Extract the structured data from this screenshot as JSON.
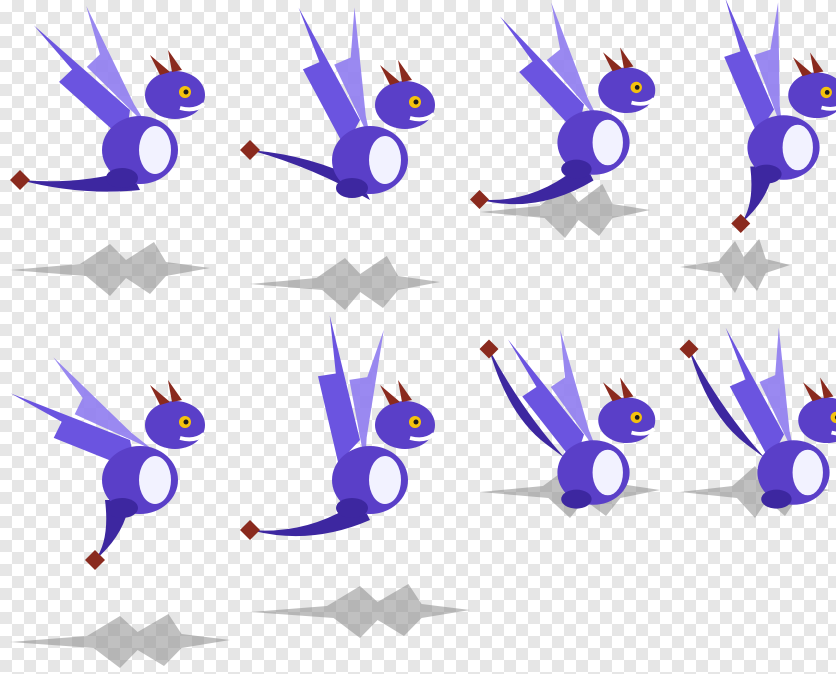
{
  "sprite_sheet": {
    "rows": 2,
    "columns": 4,
    "frame_count": 8,
    "sprite": "purple-baby-dragon",
    "has_shadow": true,
    "frames": [
      {
        "pose": "glide-left-wings-up"
      },
      {
        "pose": "glide-tail-raised"
      },
      {
        "pose": "dive-tail-back"
      },
      {
        "pose": "upright-tail-down"
      },
      {
        "pose": "upright-wing-spread"
      },
      {
        "pose": "swoop-wing-high"
      },
      {
        "pose": "tail-curled-up"
      },
      {
        "pose": "tail-curled-back"
      }
    ]
  },
  "colors": {
    "body": "#5a3fc8",
    "body_dark": "#3d27a0",
    "wing": "#6b54e0",
    "wing_light": "#8f7cf0",
    "belly": "#f2f2ff",
    "horn": "#8a2a1e",
    "eye": "#f4c20d",
    "shadow": "#8c8c8c",
    "transparency_check": "#e6e6e6"
  }
}
